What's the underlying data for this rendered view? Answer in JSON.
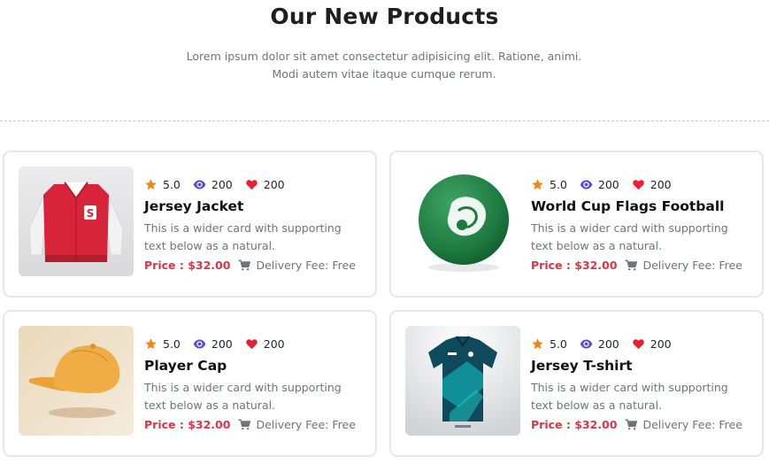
{
  "header": {
    "title": "Our New Products",
    "subtitle": "Lorem ipsum dolor sit amet consectetur adipisicing elit. Ratione, animi. Modi autem vitae itaque cumque rerum."
  },
  "colors": {
    "price": "#dc3545",
    "star": "#f5840c",
    "eye": "#5b4cdb",
    "heart": "#ea1f2f"
  },
  "products": [
    {
      "image": "red-varsity-jacket",
      "rating": "5.0",
      "views": "200",
      "likes": "200",
      "name": "Jersey Jacket",
      "description": "This is a wider card with supporting text below as a natural.",
      "price": "Price : $32.00",
      "delivery": "Delivery Fee: Free"
    },
    {
      "image": "green-football",
      "rating": "5.0",
      "views": "200",
      "likes": "200",
      "name": "World Cup Flags Football",
      "description": "This is a wider card with supporting text below as a natural.",
      "price": "Price : $32.00",
      "delivery": "Delivery Fee: Free"
    },
    {
      "image": "yellow-cap",
      "rating": "5.0",
      "views": "200",
      "likes": "200",
      "name": "Player Cap",
      "description": "This is a wider card with supporting text below as a natural.",
      "price": "Price : $32.00",
      "delivery": "Delivery Fee: Free"
    },
    {
      "image": "teal-jersey-shirt",
      "rating": "5.0",
      "views": "200",
      "likes": "200",
      "name": "Jersey T-shirt",
      "description": "This is a wider card with supporting text below as a natural.",
      "price": "Price : $32.00",
      "delivery": "Delivery Fee: Free"
    }
  ]
}
